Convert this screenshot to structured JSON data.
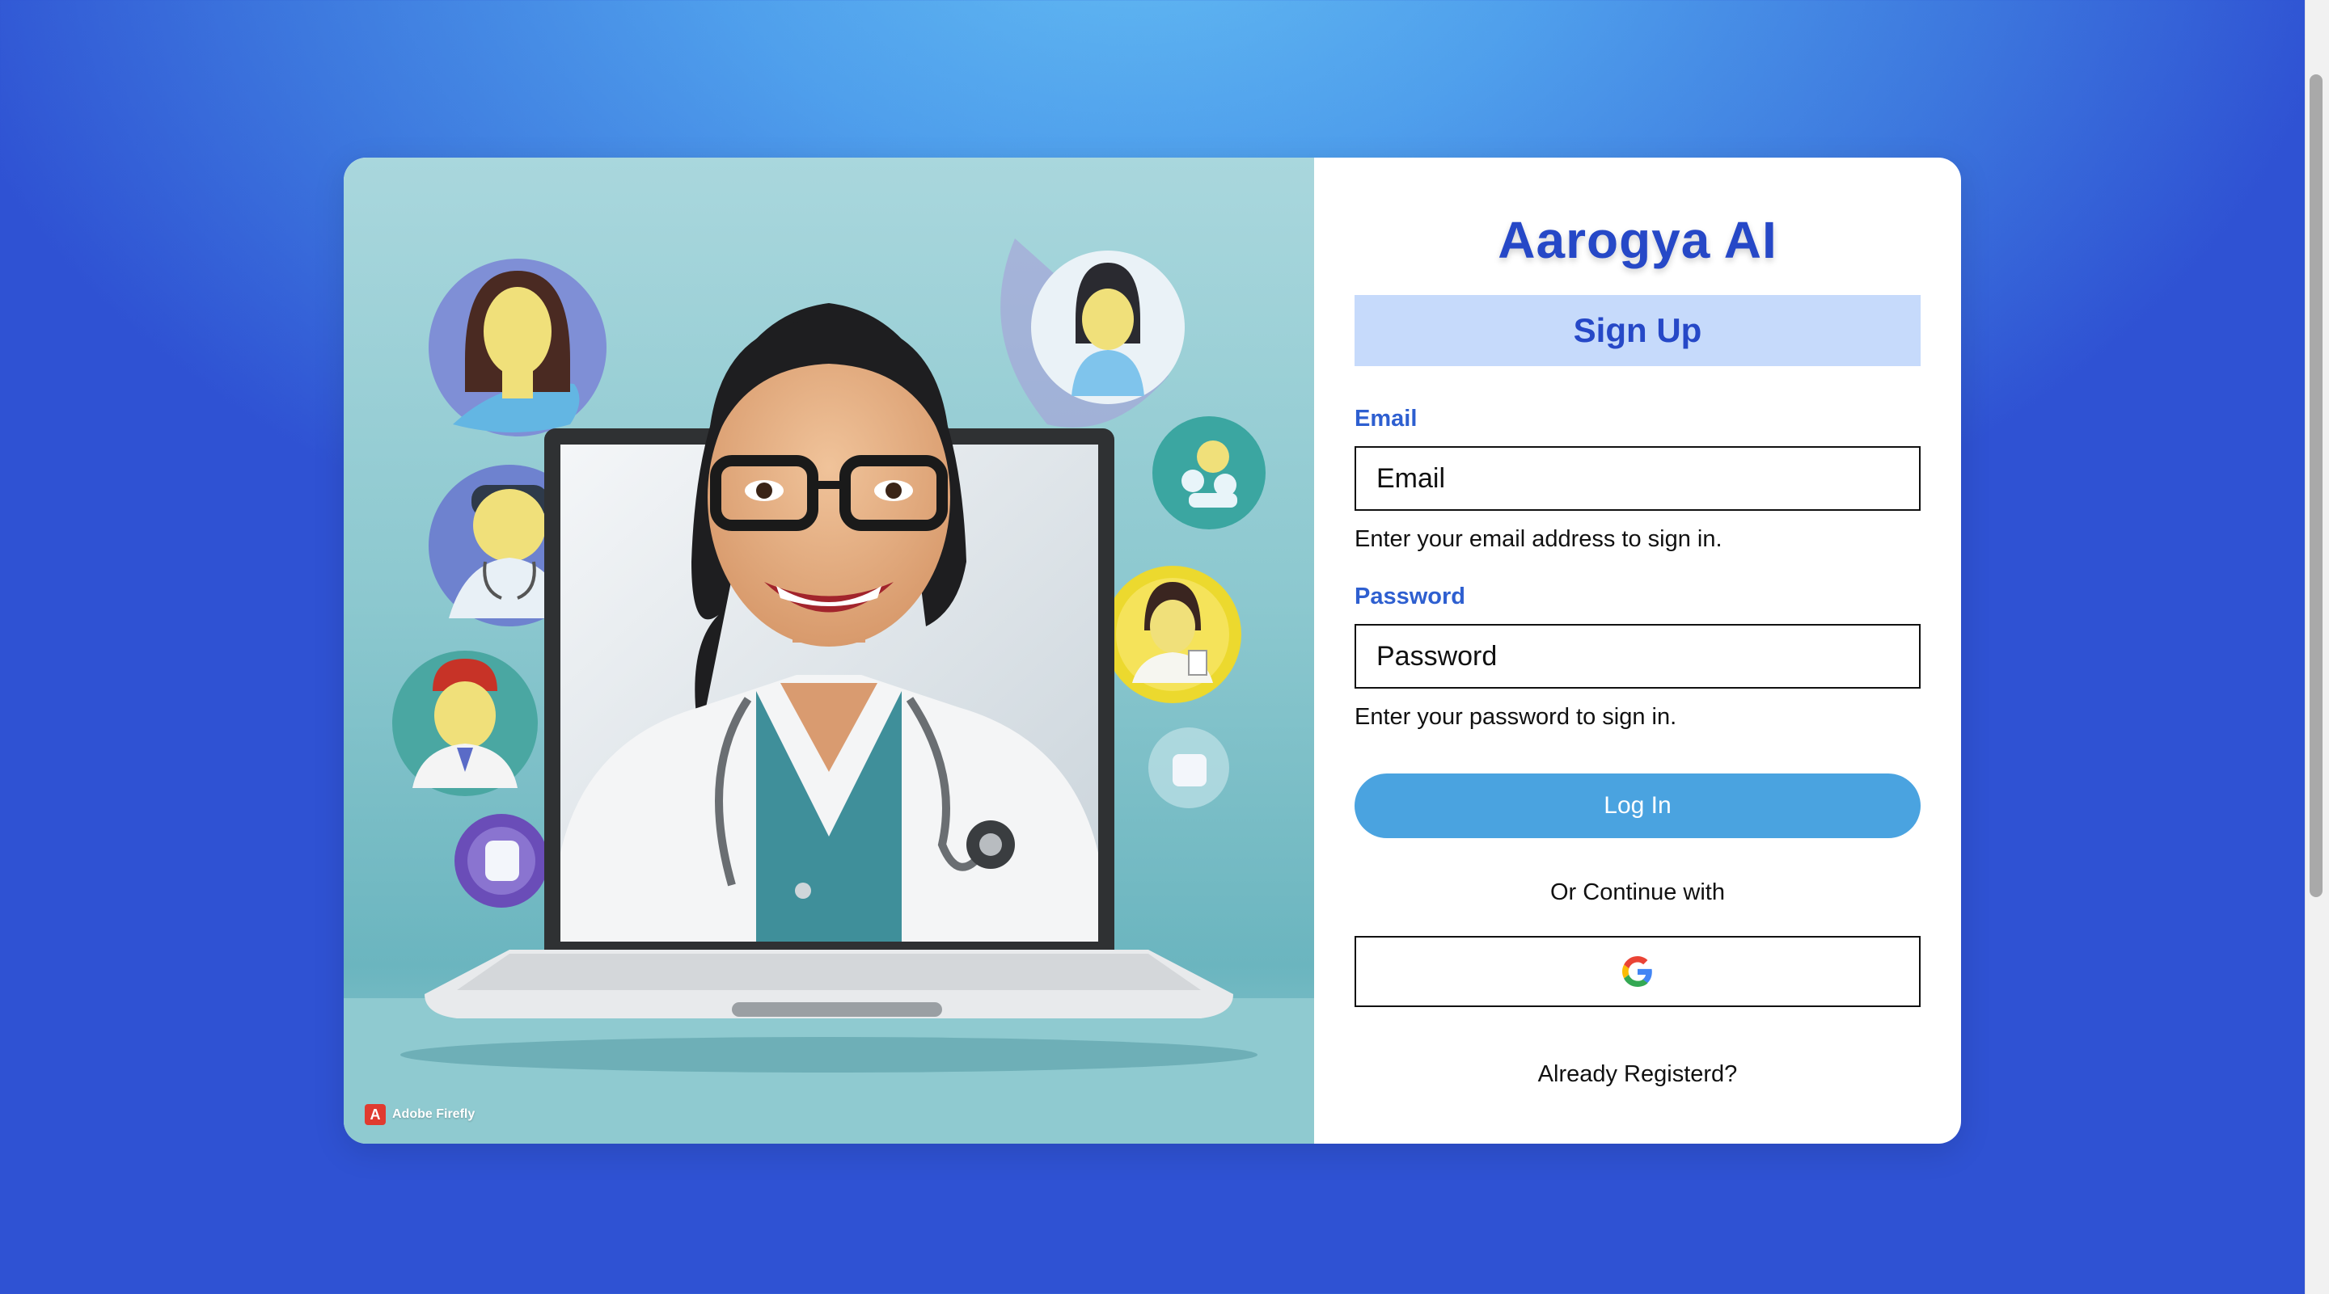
{
  "brand": {
    "title": "Aarogya AI"
  },
  "form": {
    "heading": "Sign Up",
    "email": {
      "label": "Email",
      "placeholder": "Email",
      "value": "",
      "help": "Enter your email address to sign in."
    },
    "password": {
      "label": "Password",
      "placeholder": "Password",
      "value": "",
      "help": "Enter your password to sign in."
    },
    "login_button": "Log In",
    "or_text": "Or Continue with",
    "google_icon": "google-icon",
    "already_registered": "Already Registerd?"
  },
  "illustration": {
    "description_icon": "doctor-on-laptop-illustration",
    "badge": {
      "icon": "adobe-firefly-icon",
      "letter": "A",
      "label": "Adobe Firefly"
    }
  },
  "colors": {
    "brand": "#2648c7",
    "label": "#2e5fd0",
    "heading_bg": "#c6dafb",
    "button": "#4aa3e0",
    "background_top": "#62baf2",
    "background_bottom": "#2f52d3"
  }
}
